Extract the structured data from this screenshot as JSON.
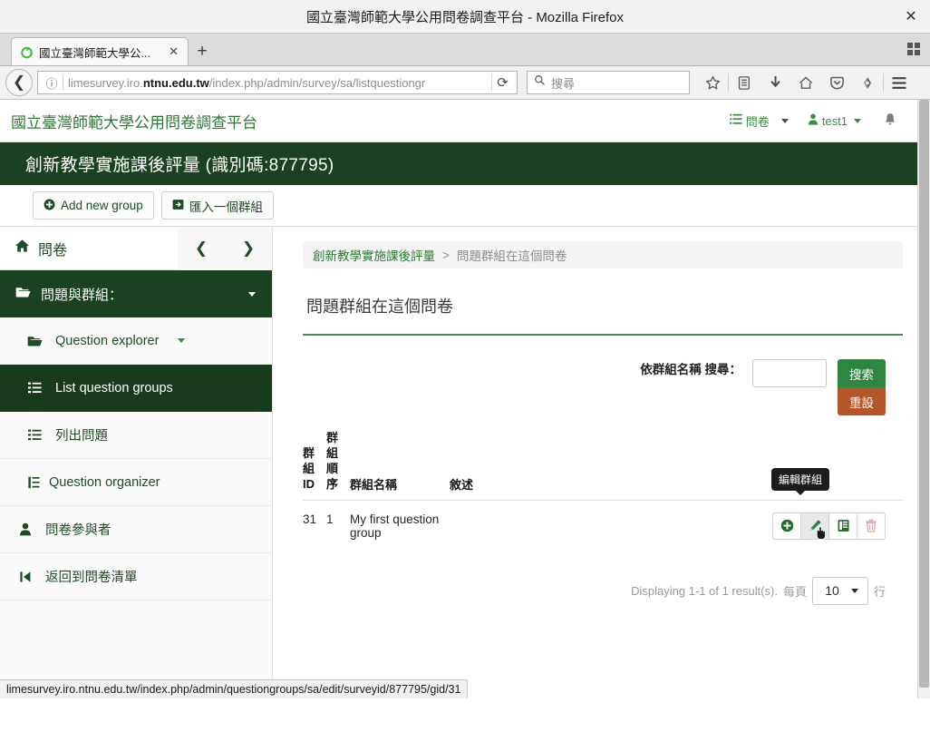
{
  "browser": {
    "window_title": "國立臺灣師範大學公用問卷調查平台 - Mozilla Firefox",
    "close_label": "✕",
    "tab": {
      "label": "國立臺灣師範大學公...",
      "close_label": "✕"
    },
    "new_tab_label": "+",
    "url_prefix": "limesurvey.iro.",
    "url_domain": "ntnu.edu.tw",
    "url_suffix": "/index.php/admin/survey/sa/listquestiongr",
    "reload_label": "⟳",
    "back_label": "❮",
    "search_placeholder": "搜尋",
    "statusbar_url": "limesurvey.iro.ntnu.edu.tw/index.php/admin/questiongroups/sa/edit/surveyid/877795/gid/31"
  },
  "app": {
    "brand": "國立臺灣師範大學公用問卷調查平台",
    "header_menu": {
      "surveys_label": "問卷",
      "user_label": "test1"
    },
    "survey_title": "創新教學實施課後評量 (識別碼:877795)"
  },
  "toolbar": {
    "add_group_label": "Add new group",
    "import_group_label": "匯入一個群組"
  },
  "sidebar": {
    "home_label": "問卷",
    "prev_label": "❮",
    "next_label": "❯",
    "section_label": "問題與群組：",
    "items": [
      {
        "label": "Question explorer",
        "icon": "folder-icon",
        "level": 1,
        "active": false,
        "has_caret": true
      },
      {
        "label": "List question groups",
        "icon": "list-icon",
        "level": 2,
        "active": true,
        "has_caret": false
      },
      {
        "label": "列出問題",
        "icon": "list-icon",
        "level": 2,
        "active": false,
        "has_caret": false
      },
      {
        "label": "Question organizer",
        "icon": "organizer-icon",
        "level": 2,
        "active": false,
        "has_caret": false
      },
      {
        "label": "問卷參與者",
        "icon": "user-icon",
        "level": 1,
        "active": false,
        "has_caret": false
      },
      {
        "label": "返回到問卷清單",
        "icon": "back-to-list-icon",
        "level": 1,
        "active": false,
        "has_caret": false
      }
    ]
  },
  "main": {
    "breadcrumb": {
      "parent": "創新教學實施課後評量",
      "separator": ">",
      "current": "問題群組在這個問卷"
    },
    "panel_title": "問題群組在這個問卷",
    "search": {
      "label": "依群組名稱\n搜尋：",
      "value": "",
      "search_button": "搜索",
      "reset_button": "重設"
    },
    "table": {
      "headers": {
        "gid": "群\n組\nID",
        "order": "群\n組\n順\n序",
        "name": "群組名稱",
        "description": "敘述",
        "actions": ""
      },
      "rows": [
        {
          "gid": "31",
          "order": "1",
          "name": "My first question group",
          "description": "",
          "actions": [
            {
              "name": "add-question-button",
              "icon": "plus-circle-icon",
              "color": "#1b6b2a"
            },
            {
              "name": "edit-group-button",
              "icon": "pencil-icon",
              "color": "#2f8a3e",
              "hovered": true
            },
            {
              "name": "view-group-button",
              "icon": "summary-icon",
              "color": "#1b6b2a"
            },
            {
              "name": "delete-group-button",
              "icon": "trash-icon",
              "color": "#e6a0a0"
            }
          ]
        }
      ],
      "tooltip": "編輯群組"
    },
    "pager": {
      "summary": "Displaying 1-1 of 1 result(s).",
      "per_page_label": "每頁",
      "per_page_value": "10",
      "rows_label": "行"
    }
  },
  "colors": {
    "dark_green": "#1b4220",
    "active_green": "#173a1b",
    "brand_green": "#2b7a34",
    "search_green": "#2f8640",
    "reset_brown": "#b4552a"
  }
}
